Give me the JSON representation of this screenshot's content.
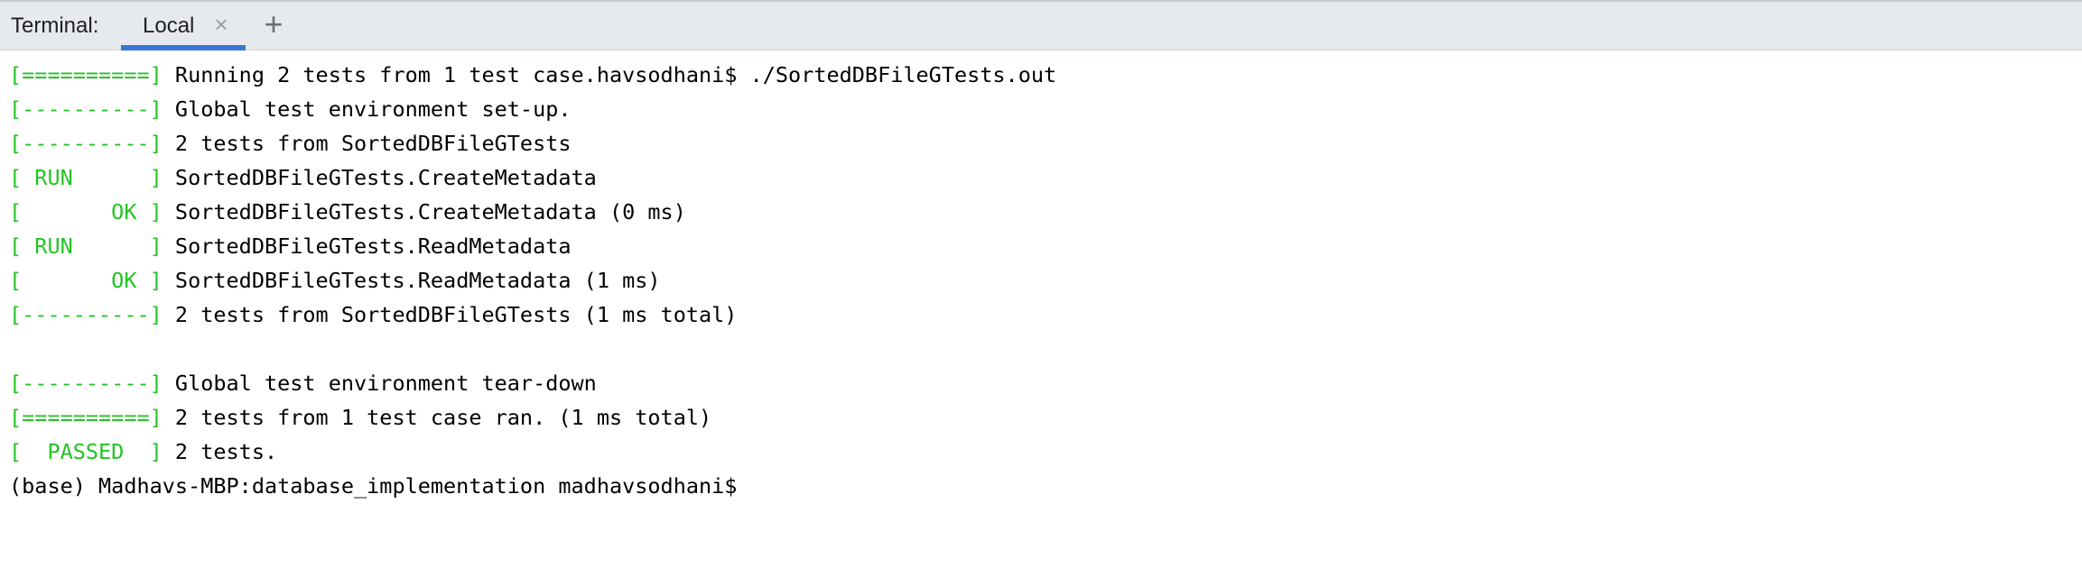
{
  "tabbar": {
    "title": "Terminal:",
    "tabs": [
      {
        "label": "Local",
        "close_icon": "×"
      }
    ],
    "add_icon": "+"
  },
  "terminal": {
    "lines": [
      {
        "tag": "[==========]",
        "text": " Running 2 tests from 1 test case.havsodhani$ ./SortedDBFileGTests.out"
      },
      {
        "tag": "[----------]",
        "text": " Global test environment set-up."
      },
      {
        "tag": "[----------]",
        "text": " 2 tests from SortedDBFileGTests"
      },
      {
        "tag": "[ RUN      ]",
        "text": " SortedDBFileGTests.CreateMetadata"
      },
      {
        "tag": "[       OK ]",
        "text": " SortedDBFileGTests.CreateMetadata (0 ms)"
      },
      {
        "tag": "[ RUN      ]",
        "text": " SortedDBFileGTests.ReadMetadata"
      },
      {
        "tag": "[       OK ]",
        "text": " SortedDBFileGTests.ReadMetadata (1 ms)"
      },
      {
        "tag": "[----------]",
        "text": " 2 tests from SortedDBFileGTests (1 ms total)"
      },
      {
        "tag": "",
        "text": ""
      },
      {
        "tag": "[----------]",
        "text": " Global test environment tear-down"
      },
      {
        "tag": "[==========]",
        "text": " 2 tests from 1 test case ran. (1 ms total)"
      },
      {
        "tag": "[  PASSED  ]",
        "text": " 2 tests."
      },
      {
        "tag": "",
        "text": "(base) Madhavs-MBP:database_implementation madhavsodhani$"
      }
    ],
    "colors": {
      "tag": "#23c423",
      "text": "#000000",
      "accent": "#3a78d4"
    }
  }
}
